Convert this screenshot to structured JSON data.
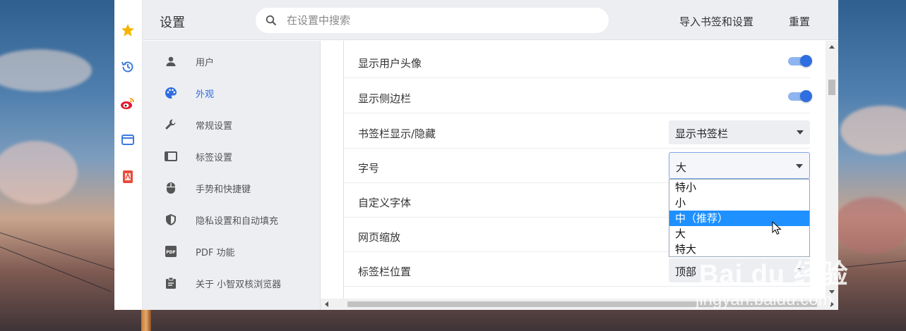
{
  "header": {
    "title": "设置",
    "search_placeholder": "在设置中搜索",
    "import_label": "导入书签和设置",
    "reset_label": "重置"
  },
  "iconbar": [
    {
      "name": "favorites-star-icon",
      "color": "#f5b400"
    },
    {
      "name": "history-icon",
      "color": "#3b7be0"
    },
    {
      "name": "weibo-icon",
      "color": "#e6162d"
    },
    {
      "name": "window-icon",
      "color": "#3b7be0"
    },
    {
      "name": "pdf-reader-icon",
      "color": "#e74c3c"
    }
  ],
  "nav": {
    "items": [
      {
        "label": "用户",
        "icon": "user-icon"
      },
      {
        "label": "外观",
        "icon": "palette-icon",
        "active": true
      },
      {
        "label": "常规设置",
        "icon": "wrench-icon"
      },
      {
        "label": "标签设置",
        "icon": "tab-icon"
      },
      {
        "label": "手势和快捷键",
        "icon": "mouse-icon"
      },
      {
        "label": "隐私设置和自动填充",
        "icon": "shield-icon"
      },
      {
        "label": "PDF 功能",
        "icon": "pdf-icon"
      },
      {
        "label": "关于 小智双核浏览器",
        "icon": "clipboard-icon"
      }
    ]
  },
  "settings": {
    "rows": [
      {
        "label": "显示用户头像",
        "control": "toggle",
        "value": "on"
      },
      {
        "label": "显示侧边栏",
        "control": "toggle",
        "value": "on"
      },
      {
        "label": "书签栏显示/隐藏",
        "control": "select",
        "value": "显示书签栏"
      },
      {
        "label": "字号",
        "control": "select",
        "value": "大"
      },
      {
        "label": "自定义字体"
      },
      {
        "label": "网页缩放"
      },
      {
        "label": "标签栏位置",
        "control": "select",
        "value": "顶部"
      }
    ]
  },
  "font_size_dropdown": {
    "options": [
      "特小",
      "小",
      "中（推荐）",
      "大",
      "特大"
    ],
    "highlighted": "中（推荐）"
  },
  "watermark": {
    "brand": "Bai du 经验",
    "url": "jingyan.baidu.com"
  },
  "colors": {
    "accent": "#2f6ee0",
    "highlight": "#1e90ff",
    "panel": "#eceef2"
  }
}
